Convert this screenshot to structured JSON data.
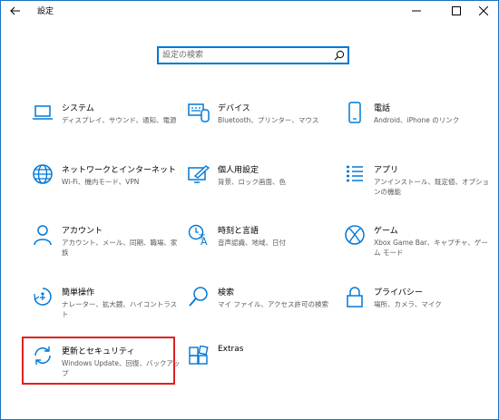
{
  "window": {
    "title": "設定",
    "back_icon": "back-arrow-icon",
    "minimize_symbol": "—",
    "maximize_symbol": "☐",
    "close_symbol": "✕"
  },
  "search": {
    "placeholder": "設定の検索",
    "icon": "search-icon"
  },
  "accent_color": "#0078d7",
  "highlight_color": "#e02020",
  "tiles": [
    {
      "title": "システム",
      "desc": "ディスプレイ、サウンド、通知、電源",
      "icon": "laptop-icon"
    },
    {
      "title": "デバイス",
      "desc": "Bluetooth、プリンター、マウス",
      "icon": "devices-icon"
    },
    {
      "title": "電話",
      "desc": "Android、iPhone のリンク",
      "icon": "phone-icon"
    },
    {
      "title": "ネットワークとインターネット",
      "desc": "Wi-Fi、機内モード、VPN",
      "icon": "globe-icon"
    },
    {
      "title": "個人用設定",
      "desc": "背景、ロック画面、色",
      "icon": "personalization-icon"
    },
    {
      "title": "アプリ",
      "desc": "アンインストール、既定値、オプションの機能",
      "icon": "apps-icon"
    },
    {
      "title": "アカウント",
      "desc": "アカウント、メール、同期、職場、家族",
      "icon": "person-icon"
    },
    {
      "title": "時刻と言語",
      "desc": "音声認識、地域、日付",
      "icon": "time-language-icon"
    },
    {
      "title": "ゲーム",
      "desc": "Xbox Game Bar、キャプチャ、ゲーム モード",
      "icon": "xbox-icon"
    },
    {
      "title": "簡単操作",
      "desc": "ナレーター、拡大鏡、ハイコントラスト",
      "icon": "ease-of-access-icon"
    },
    {
      "title": "検索",
      "desc": "マイ ファイル、アクセス許可の検索",
      "icon": "magnifier-icon"
    },
    {
      "title": "プライバシー",
      "desc": "場所、カメラ、マイク",
      "icon": "lock-icon"
    },
    {
      "title": "更新とセキュリティ",
      "desc": "Windows Update、回復、バックアップ",
      "icon": "update-icon"
    },
    {
      "title": "Extras",
      "desc": "",
      "icon": "extras-icon"
    }
  ]
}
